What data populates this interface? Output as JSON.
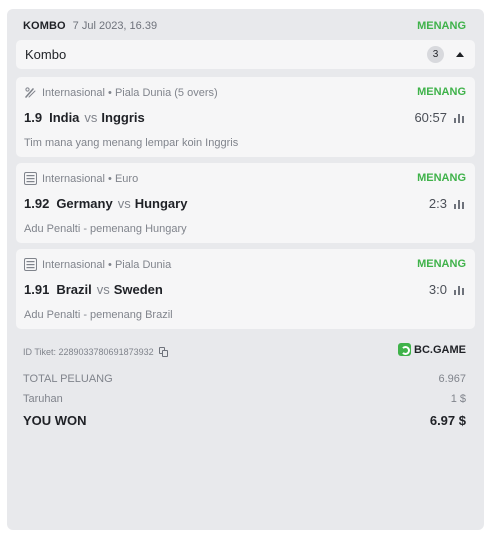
{
  "ticket": {
    "type_label": "KOMBO",
    "date": "7 Jul 2023, 16.39",
    "status": "MENANG"
  },
  "combo": {
    "title": "Kombo",
    "count": "3",
    "collapse_icon": "caret-up-icon"
  },
  "bets": [
    {
      "icon": "cricket-icon",
      "meta": "Internasional • Piala Dunia (5 overs)",
      "status": "MENANG",
      "odds": "1.9",
      "team1": "India",
      "vs": "vs",
      "team2": "Inggris",
      "score": "60:57",
      "market": "Tim mana yang menang lempar koin Inggris"
    },
    {
      "icon": "fifa-icon",
      "meta": "Internasional • Euro",
      "status": "MENANG",
      "odds": "1.92",
      "team1": "Germany",
      "vs": "vs",
      "team2": "Hungary",
      "score": "2:3",
      "market": "Adu Penalti - pemenang Hungary"
    },
    {
      "icon": "fifa-icon",
      "meta": "Internasional • Piala Dunia",
      "status": "MENANG",
      "odds": "1.91",
      "team1": "Brazil",
      "vs": "vs",
      "team2": "Sweden",
      "score": "3:0",
      "market": "Adu Penalti - pemenang Brazil"
    }
  ],
  "footer": {
    "ticket_id": "ID Tiket: 2289033780691873932",
    "brand": "BC.GAME",
    "total_odds_label": "TOTAL PELUANG",
    "total_odds_value": "6.967",
    "stake_label": "Taruhan",
    "stake_value": "1 $",
    "won_label": "YOU WON",
    "won_value": "6.97 $"
  },
  "colors": {
    "win_green": "#3fb24a",
    "card_bg": "#f6f6f7",
    "ticket_bg": "#e8e9ec"
  }
}
